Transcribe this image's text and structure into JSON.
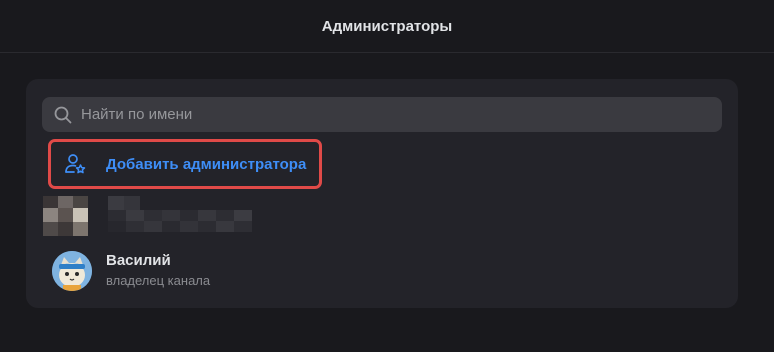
{
  "header": {
    "title": "Администраторы"
  },
  "search": {
    "placeholder": "Найти по имени",
    "value": ""
  },
  "actions": {
    "add_admin_label": "Добавить администратора"
  },
  "admins": [
    {
      "name": "Василий",
      "role": "владелец канала"
    }
  ],
  "colors": {
    "accent": "#3e8ef7",
    "highlight_border": "#e04a48",
    "card_bg": "#232329",
    "page_bg": "#19191d"
  },
  "icons": {
    "search": "search-icon",
    "add_admin": "user-star-icon"
  }
}
